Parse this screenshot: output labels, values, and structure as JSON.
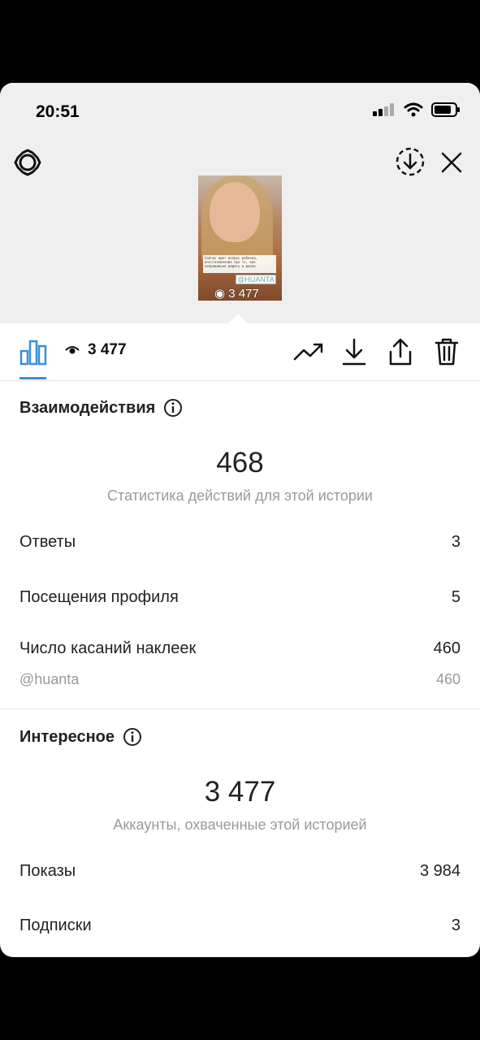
{
  "status_bar": {
    "time": "20:51"
  },
  "preview": {
    "views": "3 477",
    "sticker_tag": "@HUANTA",
    "caption_text": "Сейчас идет вопрос ребенка, восстановления про то, как неправильно видеть в школе"
  },
  "toolbar": {
    "views_count": "3 477"
  },
  "interactions": {
    "title": "Взаимодействия",
    "total": "468",
    "total_caption": "Статистика действий для этой истории",
    "rows": [
      {
        "label": "Ответы",
        "value": "3"
      },
      {
        "label": "Посещения профиля",
        "value": "5"
      },
      {
        "label": "Число касаний наклеек",
        "value": "460"
      }
    ],
    "sub_rows": [
      {
        "label": "@huanta",
        "value": "460"
      }
    ]
  },
  "discovery": {
    "title": "Интересное",
    "total": "3 477",
    "total_caption": "Аккаунты, охваченные этой историей",
    "rows": [
      {
        "label": "Показы",
        "value": "3 984"
      },
      {
        "label": "Подписки",
        "value": "3"
      }
    ]
  },
  "colors": {
    "accent": "#3b8fd8",
    "muted_text": "#9a9a9a",
    "header_bg": "#efefef"
  },
  "icons": [
    "settings-gear-icon",
    "download-circle-icon",
    "close-icon",
    "bar-chart-icon",
    "eye-icon",
    "trend-icon",
    "download-icon",
    "share-icon",
    "trash-icon",
    "info-icon"
  ]
}
